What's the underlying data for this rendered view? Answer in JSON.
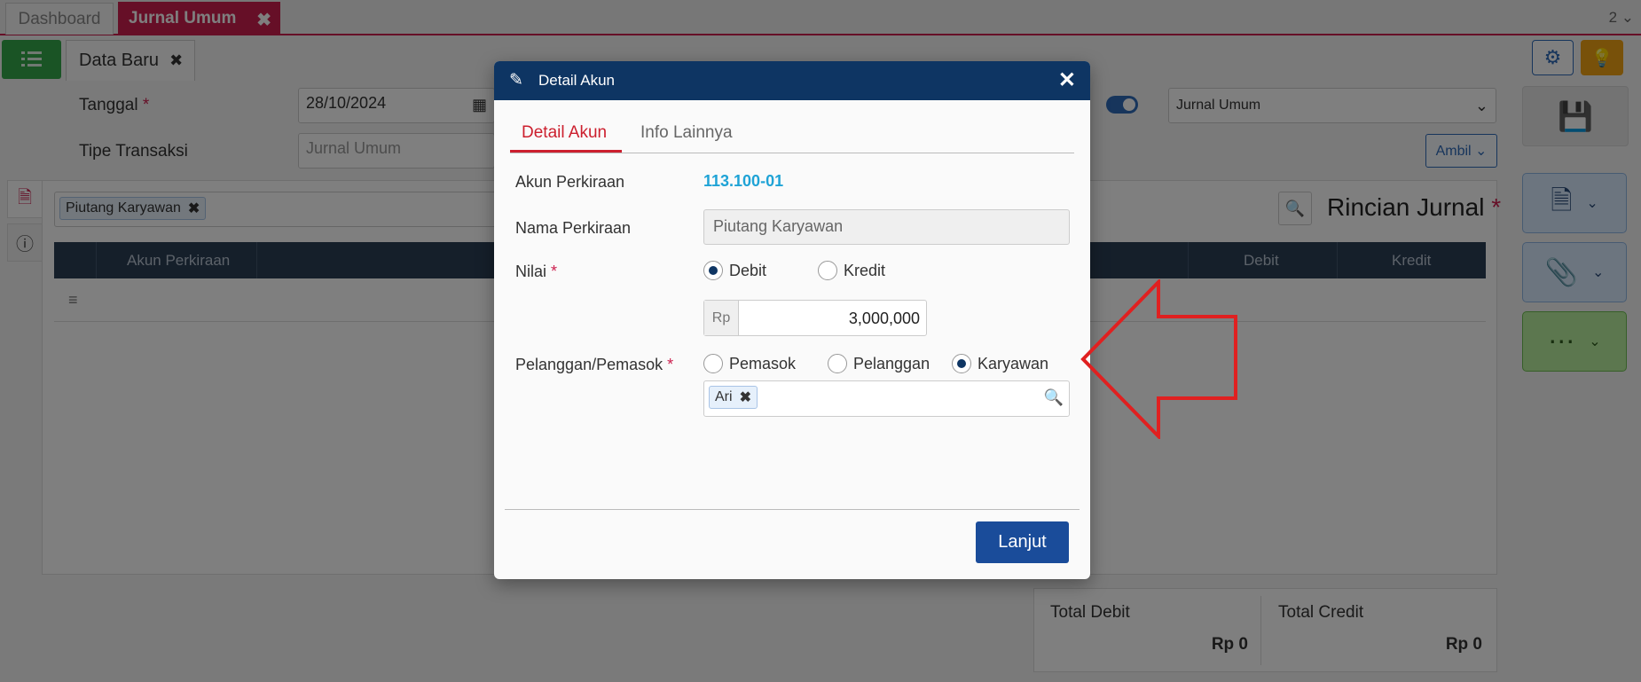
{
  "tabs": {
    "dashboard": "Dashboard",
    "jurnal_umum": "Jurnal Umum",
    "close_symbol": "✖",
    "page_counter": "2 ⌄"
  },
  "subtab": {
    "label": "Data Baru",
    "close_symbol": "✖"
  },
  "form": {
    "tanggal_label": "Tanggal",
    "tanggal_value": "28/10/2024",
    "tipe_label": "Tipe Transaksi",
    "tipe_placeholder": "Jurnal Umum",
    "jenis_select": "Jurnal Umum",
    "ambil_label": "Ambil ⌄",
    "required_mark": "*"
  },
  "detail": {
    "filter_chip": "Piutang Karyawan",
    "rincian_title": "Rincian Jurnal",
    "columns": [
      "Akun Perkiraan",
      "Debit",
      "Kredit"
    ]
  },
  "totals": {
    "debit_label": "Total Debit",
    "debit_value": "Rp 0",
    "credit_label": "Total Credit",
    "credit_value": "Rp 0"
  },
  "modal": {
    "title": "Detail Akun",
    "close_symbol": "✕",
    "tabs": [
      "Detail Akun",
      "Info Lainnya"
    ],
    "akun_label": "Akun Perkiraan",
    "akun_value": "113.100-01",
    "nama_label": "Nama Perkiraan",
    "nama_value": "Piutang Karyawan",
    "nilai_label": "Nilai",
    "nilai_options": [
      "Debit",
      "Kredit"
    ],
    "nilai_selected": "Debit",
    "currency_prefix": "Rp",
    "amount": "3,000,000",
    "pelanggan_label": "Pelanggan/Pemasok",
    "pelanggan_options": [
      "Pemasok",
      "Pelanggan",
      "Karyawan"
    ],
    "pelanggan_selected": "Karyawan",
    "karyawan_chip": "Ari",
    "submit_label": "Lanjut"
  },
  "colors": {
    "accent_red": "#cc1f4e",
    "modal_header": "#0e3563",
    "primary_button": "#1a4c9a",
    "link_blue": "#1fa3d6",
    "arrow_red": "#e02020"
  }
}
